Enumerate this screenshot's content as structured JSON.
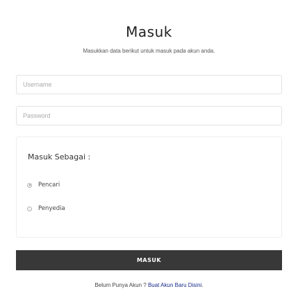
{
  "header": {
    "title": "Masuk",
    "subtitle": "Masukkan data berikut untuk masuk pada akun anda."
  },
  "form": {
    "username": {
      "placeholder": "Username",
      "value": ""
    },
    "password": {
      "placeholder": "Password",
      "value": ""
    },
    "role": {
      "label": "Masuk Sebagai :",
      "options": [
        {
          "label": "Pencari",
          "selected": true
        },
        {
          "label": "Penyedia",
          "selected": false
        }
      ]
    },
    "submit_label": "MASUK"
  },
  "footer": {
    "prompt": "Belum Punya Akun ? ",
    "link_text": "Buat Akun Baru Disini",
    "suffix": "."
  },
  "colors": {
    "button_bg": "#383838",
    "link": "#1a2a8c",
    "border": "#e2e2e2"
  }
}
